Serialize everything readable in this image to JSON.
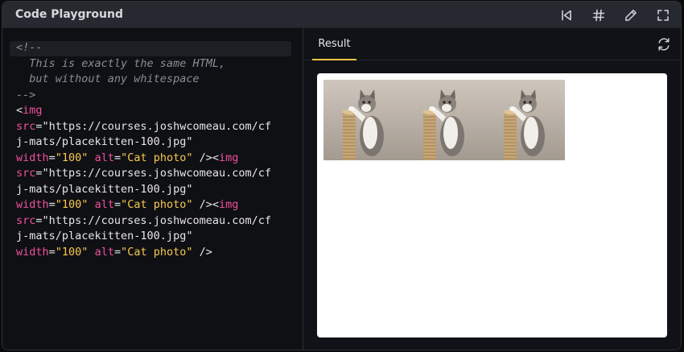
{
  "titlebar": {
    "title": "Code Playground",
    "icons": [
      "skip-back-icon",
      "hash-icon",
      "pencil-icon",
      "fullscreen-icon"
    ]
  },
  "editor": {
    "lines": [
      "<!--",
      "  This is exactly the same HTML,",
      "  but without any whitespace",
      "-->",
      "<img",
      "src=\"https://courses.joshwcomeau.com/cf",
      "j-mats/placekitten-100.jpg\"",
      "width=\"100\" alt=\"Cat photo\" /><img",
      "src=\"https://courses.joshwcomeau.com/cf",
      "j-mats/placekitten-100.jpg\"",
      "width=\"100\" alt=\"Cat photo\" /><img",
      "src=\"https://courses.joshwcomeau.com/cf",
      "j-mats/placekitten-100.jpg\"",
      "width=\"100\" alt=\"Cat photo\" />"
    ]
  },
  "results": {
    "tab_label": "Result",
    "refresh_icon": "refresh-icon",
    "images": [
      {
        "alt": "Cat photo"
      },
      {
        "alt": "Cat photo"
      },
      {
        "alt": "Cat photo"
      }
    ]
  },
  "colors": {
    "accent": "#f4c547",
    "tag": "#f0509b",
    "string": "#f8c94e",
    "comment": "#8a8e97"
  }
}
